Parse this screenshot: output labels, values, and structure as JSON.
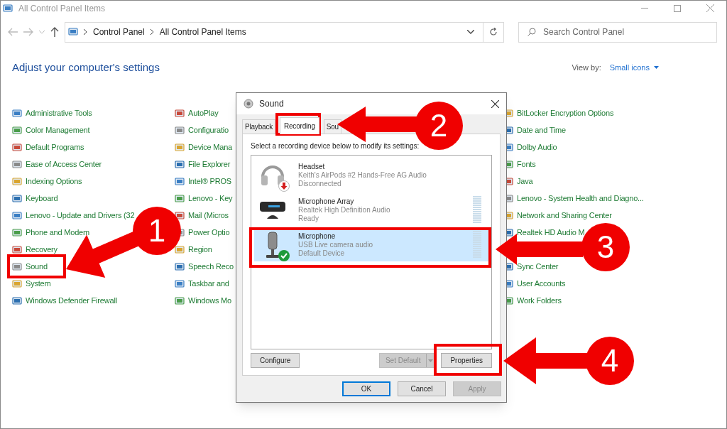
{
  "window": {
    "title": "All Control Panel Items"
  },
  "address": {
    "crumbs": [
      "Control Panel",
      "All Control Panel Items"
    ]
  },
  "search": {
    "placeholder": "Search Control Panel"
  },
  "heading": "Adjust your computer's settings",
  "view_by": {
    "label": "View by:",
    "value": "Small icons"
  },
  "columns": [
    [
      [
        {
          "label": "Administrative Tools"
        },
        {
          "label": "Color Management"
        },
        {
          "label": "Default Programs"
        },
        {
          "label": "Ease of Access Center"
        },
        {
          "label": "Indexing Options"
        },
        {
          "label": "Keyboard"
        },
        {
          "label": "Lenovo - Update and Drivers (32"
        },
        {
          "label": "Phone and Modem"
        },
        {
          "label": "Recovery"
        },
        {
          "label": "Sound"
        },
        {
          "label": "System"
        },
        {
          "label": "Windows Defender Firewall"
        }
      ]
    ],
    [
      [
        {
          "label": "AutoPlay"
        },
        {
          "label": "Configuratio"
        },
        {
          "label": "Device Mana"
        },
        {
          "label": "File Explorer"
        },
        {
          "label": "Intel® PROS"
        },
        {
          "label": "Lenovo - Key"
        },
        {
          "label": "Mail (Micros"
        },
        {
          "label": "Power Optio"
        },
        {
          "label": "Region"
        },
        {
          "label": "Speech Reco"
        },
        {
          "label": "Taskbar and"
        },
        {
          "label": "Windows Mo"
        }
      ]
    ],
    [
      [
        {
          "label": "BitLocker Encryption Options"
        },
        {
          "label": "Date and Time"
        },
        {
          "label": "Dolby Audio"
        },
        {
          "label": "Fonts"
        },
        {
          "label": "Java"
        },
        {
          "label": "Lenovo - System Health and Diagno..."
        },
        {
          "label": "Network and Sharing Center"
        },
        {
          "label": "Realtek HD Audio M"
        }
      ],
      [
        {
          "label": "Sync Center"
        },
        {
          "label": "User Accounts"
        },
        {
          "label": "Work Folders"
        }
      ]
    ]
  ],
  "dialog": {
    "title": "Sound",
    "tabs": [
      {
        "label": "Playback",
        "selected": false
      },
      {
        "label": "Recording",
        "selected": true
      },
      {
        "label": "Sou",
        "selected": false
      }
    ],
    "instruction": "Select a recording device below to modify its settings:",
    "devices": [
      {
        "kind": "headset",
        "name": "Headset",
        "detail": "Keith's AirPods #2 Hands-Free AG Audio",
        "status": "Disconnected",
        "disconnected": true,
        "default_device": false,
        "meter": false,
        "selected": false
      },
      {
        "kind": "array",
        "name": "Microphone Array",
        "detail": "Realtek High Definition Audio",
        "status": "Ready",
        "disconnected": false,
        "default_device": false,
        "meter": true,
        "selected": false
      },
      {
        "kind": "microphone",
        "name": "Microphone",
        "detail": "USB Live camera audio",
        "status": "Default Device",
        "disconnected": false,
        "default_device": true,
        "meter": true,
        "selected": true
      }
    ],
    "list_buttons": [
      {
        "label": "Configure",
        "disabled": false
      },
      {
        "label": "Set Default",
        "disabled": true,
        "split": true
      },
      {
        "label": "Properties",
        "disabled": false
      }
    ],
    "buttons": [
      {
        "label": "OK",
        "disabled": false,
        "default": true
      },
      {
        "label": "Cancel",
        "disabled": false,
        "default": false
      },
      {
        "label": "Apply",
        "disabled": true,
        "default": false
      }
    ]
  },
  "annotations": [
    {
      "number": "1"
    },
    {
      "number": "2"
    },
    {
      "number": "3"
    },
    {
      "number": "4"
    }
  ]
}
